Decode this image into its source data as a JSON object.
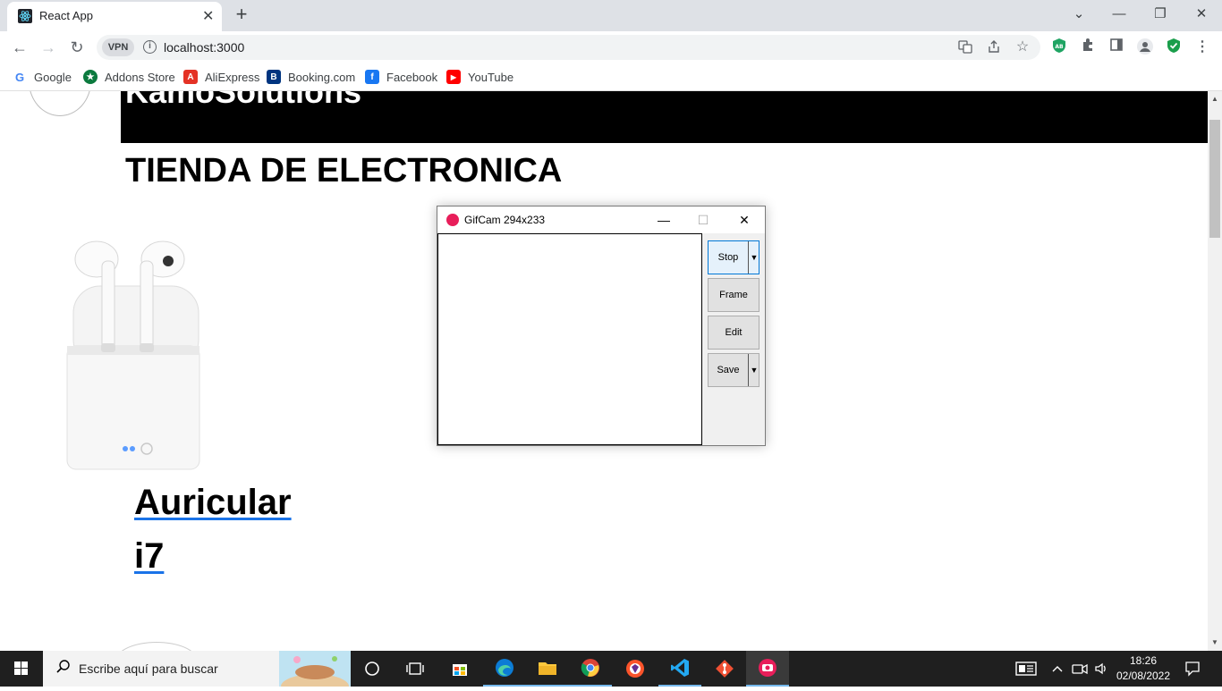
{
  "browser": {
    "tab_title": "React App",
    "tab_close": "✕",
    "new_tab": "+",
    "window_controls": {
      "chevron": "⌄",
      "minimize": "—",
      "restore": "❐",
      "close": "✕"
    },
    "nav": {
      "back": "←",
      "forward": "→",
      "reload": "↻"
    },
    "vpn_label": "VPN",
    "info_icon": "i",
    "url": "localhost:3000",
    "bookmarks": [
      {
        "label": "Google",
        "icon": "google-icon",
        "color": "#4285f4",
        "glyph": "G"
      },
      {
        "label": "Addons Store",
        "icon": "addons-store-icon",
        "color": "#0b7a3e",
        "glyph": "★"
      },
      {
        "label": "AliExpress",
        "icon": "aliexpress-icon",
        "color": "#e43225",
        "glyph": "A"
      },
      {
        "label": "Booking.com",
        "icon": "booking-icon",
        "color": "#003580",
        "glyph": "B"
      },
      {
        "label": "Facebook",
        "icon": "facebook-icon",
        "color": "#1877f2",
        "glyph": "f"
      },
      {
        "label": "YouTube",
        "icon": "youtube-icon",
        "color": "#ff0000",
        "glyph": "▶"
      }
    ]
  },
  "page": {
    "brand": "KamoSolutions",
    "store_title": "TIENDA DE ELECTRONICA",
    "product": {
      "name_line1": "Auricular",
      "name_line2": "i7",
      "image": "wireless-earbuds-image"
    }
  },
  "gifcam": {
    "title": "GifCam 294x233",
    "controls": {
      "minimize": "—",
      "maximize": "☐",
      "close": "✕"
    },
    "buttons": {
      "stop": "Stop",
      "frame": "Frame",
      "edit": "Edit",
      "save": "Save",
      "dropdown": "▼"
    }
  },
  "taskbar": {
    "search_placeholder": "Escribe aquí para buscar",
    "time": "18:26",
    "date": "02/08/2022"
  },
  "colors": {
    "accent": "#1a73e8",
    "header_band": "#000000",
    "taskbar": "#1f1f1f"
  }
}
